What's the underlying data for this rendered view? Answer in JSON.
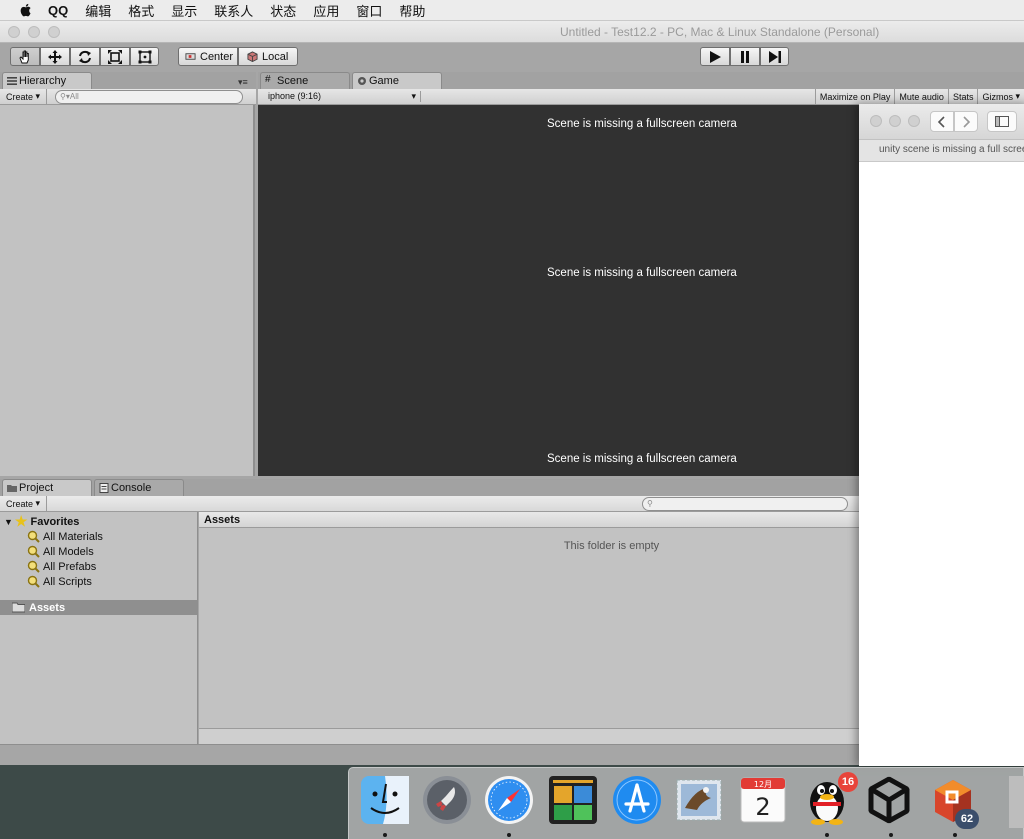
{
  "menubar": {
    "items": [
      "QQ",
      "编辑",
      "格式",
      "显示",
      "联系人",
      "状态",
      "应用",
      "窗口",
      "帮助"
    ]
  },
  "window": {
    "title": "Untitled - Test12.2 - PC, Mac & Linux Standalone (Personal)"
  },
  "toolbar": {
    "tools": [
      "hand-icon",
      "move-icon",
      "rotate-icon",
      "scale-icon",
      "rect-icon"
    ],
    "pivot_label": "Center",
    "space_label": "Local",
    "play": [
      "play-icon",
      "pause-icon",
      "step-icon"
    ]
  },
  "hierarchy": {
    "tab_label": "Hierarchy",
    "create_label": "Create",
    "search_placeholder": "All"
  },
  "scene_tabs": {
    "scene_label": "Scene",
    "game_label": "Game"
  },
  "game_bar": {
    "aspect": "iphone (9:16)",
    "maximize": "Maximize on Play",
    "mute": "Mute audio",
    "stats": "Stats",
    "gizmos": "Gizmos"
  },
  "game_view": {
    "messages": [
      "Scene is missing a fullscreen camera",
      "Scene is missing a fullscreen camera",
      "Scene is missing a fullscreen camera"
    ]
  },
  "project": {
    "tab_label": "Project",
    "console_label": "Console",
    "create_label": "Create",
    "favorites_label": "Favorites",
    "favorites": [
      "All Materials",
      "All Models",
      "All Prefabs",
      "All Scripts"
    ],
    "assets_folder": "Assets",
    "assets_header": "Assets",
    "empty_text": "This folder is empty"
  },
  "safari": {
    "tab_text": "unity scene is missing a full screen camera"
  },
  "dock": {
    "apps": [
      "finder-icon",
      "launchpad-icon",
      "safari-icon",
      "photo-booth-icon",
      "app-store-icon",
      "mail-icon",
      "calendar-icon",
      "qq-icon",
      "unity-icon",
      "parallels-icon"
    ],
    "calendar_month": "12月",
    "calendar_day": "2",
    "qq_badge": "16",
    "parallels_badge": "62",
    "colors": {
      "badge": "#e8443a",
      "game_bg": "#313131"
    }
  }
}
